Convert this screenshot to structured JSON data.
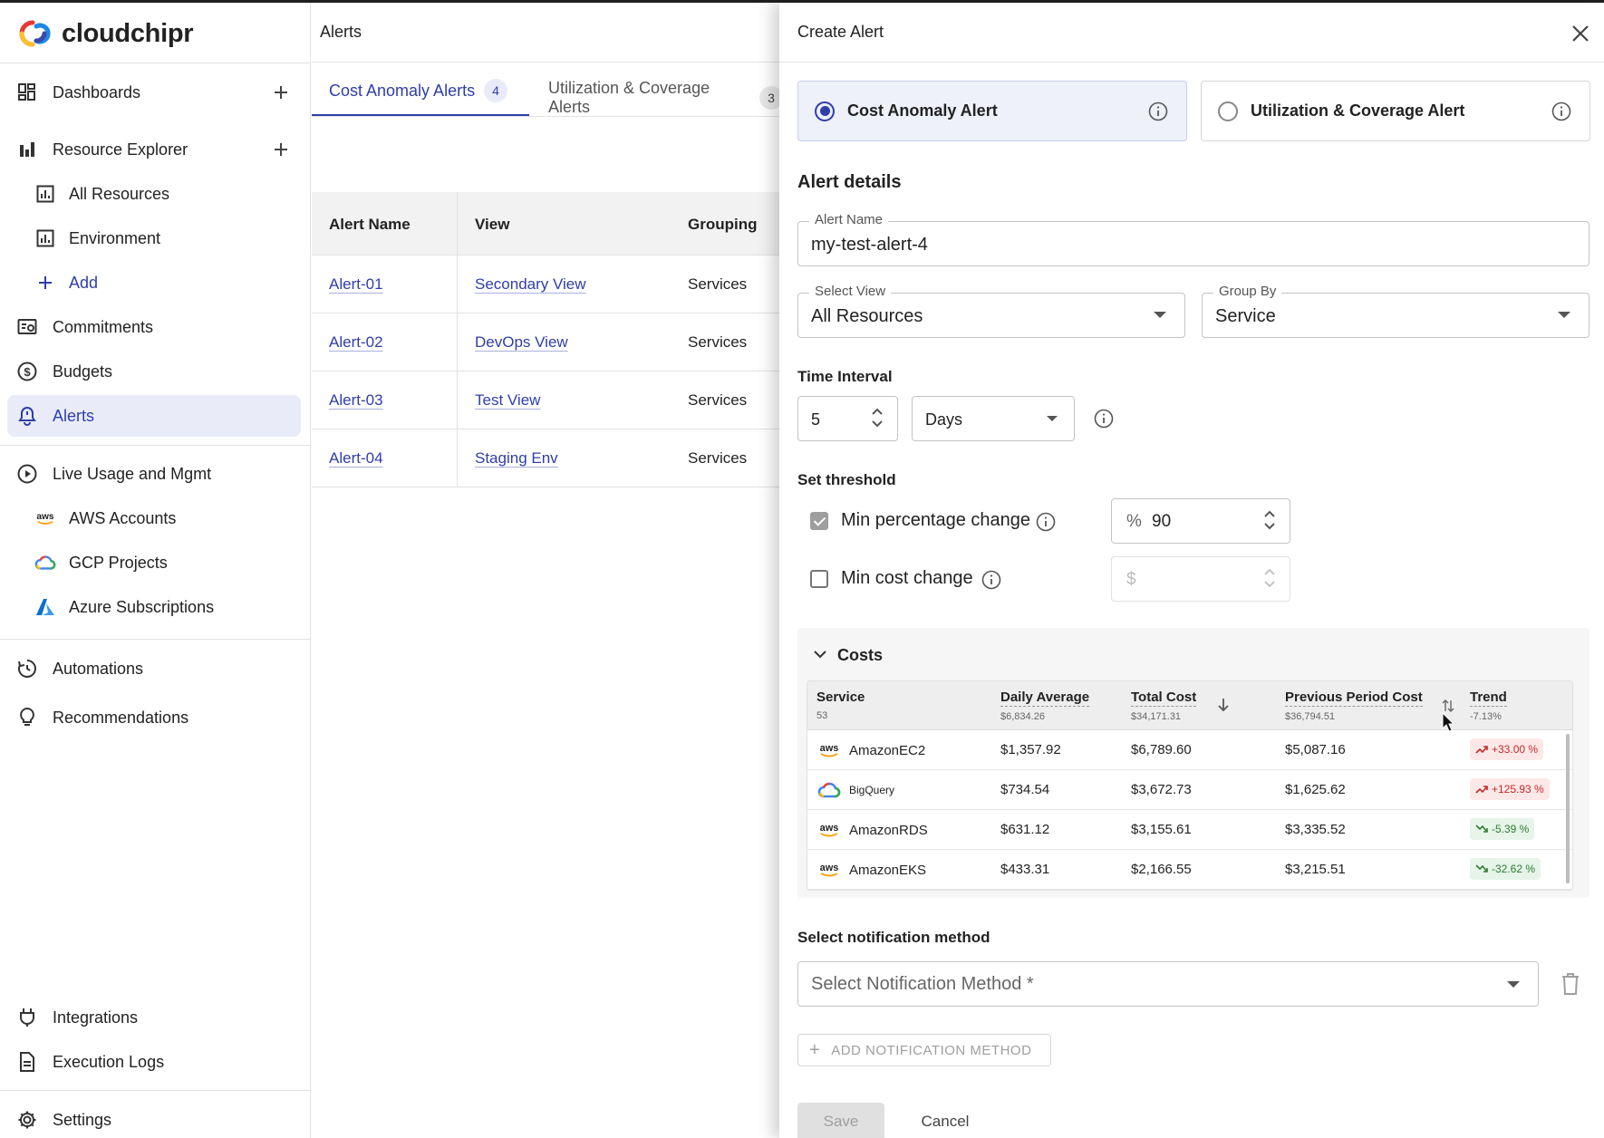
{
  "app": {
    "brand": "cloudchipr",
    "accent": "#2f3ea8"
  },
  "sidebar": {
    "items": [
      {
        "label": "Dashboards",
        "icon": "dashboard-icon"
      },
      {
        "label": "Resource Explorer",
        "icon": "bar-chart-icon"
      },
      {
        "label": "All Resources",
        "icon": "report-icon"
      },
      {
        "label": "Environment",
        "icon": "report-icon"
      },
      {
        "label": "Add",
        "icon": "plus-icon"
      },
      {
        "label": "Commitments",
        "icon": "commitments-icon"
      },
      {
        "label": "Budgets",
        "icon": "dollar-icon"
      },
      {
        "label": "Alerts",
        "icon": "bell-icon"
      },
      {
        "label": "Live Usage and Mgmt",
        "icon": "play-circle-icon"
      },
      {
        "label": "AWS Accounts",
        "icon": "aws-icon"
      },
      {
        "label": "GCP Projects",
        "icon": "gcp-icon"
      },
      {
        "label": "Azure Subscriptions",
        "icon": "azure-icon"
      },
      {
        "label": "Automations",
        "icon": "automation-icon"
      },
      {
        "label": "Recommendations",
        "icon": "lightbulb-icon"
      },
      {
        "label": "Integrations",
        "icon": "plug-icon"
      },
      {
        "label": "Execution Logs",
        "icon": "document-icon"
      },
      {
        "label": "Settings",
        "icon": "gear-icon"
      }
    ]
  },
  "main": {
    "title": "Alerts",
    "tabs": [
      {
        "label": "Cost Anomaly Alerts",
        "count": "4"
      },
      {
        "label": "Utilization & Coverage Alerts",
        "count": "3"
      }
    ],
    "columns": [
      "Alert Name",
      "View",
      "Grouping"
    ],
    "rows": [
      {
        "name": "Alert-01",
        "view": "Secondary View",
        "grouping": "Services"
      },
      {
        "name": "Alert-02",
        "view": "DevOps View",
        "grouping": "Services"
      },
      {
        "name": "Alert-03",
        "view": "Test View",
        "grouping": "Services"
      },
      {
        "name": "Alert-04",
        "view": "Staging Env",
        "grouping": "Services"
      }
    ]
  },
  "drawer": {
    "title": "Create Alert",
    "alert_types": [
      {
        "label": "Cost Anomaly Alert",
        "selected": true
      },
      {
        "label": "Utilization & Coverage Alert",
        "selected": false
      }
    ],
    "details_title": "Alert details",
    "alert_name": {
      "label": "Alert Name",
      "value": "my-test-alert-4"
    },
    "select_view": {
      "label": "Select View",
      "value": "All Resources"
    },
    "group_by": {
      "label": "Group By",
      "value": "Service"
    },
    "time_interval": {
      "label": "Time Interval",
      "value": "5",
      "unit": "Days"
    },
    "threshold": {
      "label": "Set threshold",
      "min_percentage": {
        "label": "Min percentage change",
        "checked": true,
        "prefix": "%",
        "value": "90"
      },
      "min_cost": {
        "label": "Min cost change",
        "checked": false,
        "prefix": "$",
        "value": ""
      }
    },
    "costs": {
      "title": "Costs",
      "columns": [
        {
          "name": "Service",
          "sub": "53"
        },
        {
          "name": "Daily Average",
          "sub": "$6,834.26"
        },
        {
          "name": "Total Cost",
          "sub": "$34,171.31"
        },
        {
          "name": "Previous Period Cost",
          "sub": "$36,794.51"
        },
        {
          "name": "Trend",
          "sub": "-7.13%"
        }
      ],
      "rows": [
        {
          "service": "AmazonEC2",
          "provider": "aws",
          "daily": "$1,357.92",
          "total": "$6,789.60",
          "prev": "$5,087.16",
          "trend": "+33.00 %",
          "dir": "up"
        },
        {
          "service": "BigQuery",
          "provider": "gcp",
          "daily": "$734.54",
          "total": "$3,672.73",
          "prev": "$1,625.62",
          "trend": "+125.93 %",
          "dir": "up"
        },
        {
          "service": "AmazonRDS",
          "provider": "aws",
          "daily": "$631.12",
          "total": "$3,155.61",
          "prev": "$3,335.52",
          "trend": "-5.39 %",
          "dir": "down"
        },
        {
          "service": "AmazonEKS",
          "provider": "aws",
          "daily": "$433.31",
          "total": "$2,166.55",
          "prev": "$3,215.51",
          "trend": "-32.62 %",
          "dir": "down"
        }
      ]
    },
    "notification": {
      "title": "Select notification method",
      "placeholder": "Select Notification Method *",
      "add_label": "ADD NOTIFICATION METHOD"
    },
    "save_label": "Save",
    "cancel_label": "Cancel"
  }
}
